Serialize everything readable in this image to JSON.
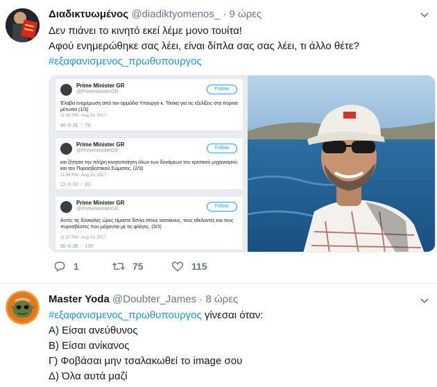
{
  "tweet1": {
    "name": "Διαδικτυωμένος",
    "handle": "@diadiktyomenos_",
    "separator": "·",
    "time": "9 ώρες",
    "line1": "Δεν πιάνει το κινητό εκεί λέμε μονο τουίτα!",
    "line2": "Αφού ενημερώθηκε σας λέει, είναι δίπλα σας σας λέει, τι άλλο θέτε?",
    "hashtag": "#εξαφανισμενος_πρωθυπουργος",
    "embedded": [
      {
        "name": "Prime Minister GR",
        "handle": "@PrimeministerGR",
        "follow": "Follow",
        "text": "Έλαβα ενημέρωση από τον αρμόδιο Υπουργό κ. Τόσκα για τις εξελίξεις στα πύρινα μέτωπα (1/3)",
        "time": "11:36 PM - Aug 13, 2017",
        "stats": "46   ⟲ 36   ♡ 79"
      },
      {
        "name": "Prime Minister GR",
        "handle": "@PrimeministerGR",
        "follow": "Follow",
        "text": "και ζήτησα την πλήρη κινητοποίηση όλων των δυνάμεων του κρατικού μηχανισμού και του Πυροσβεστικού Σώματος. (2/3)",
        "time": "11:36 PM - Aug 13, 2017",
        "stats": "22   ⟲ 33   ♡ 83"
      },
      {
        "name": "Prime Minister GR",
        "handle": "@PrimeministerGR",
        "follow": "Follow",
        "text": "Αυτές τις δύσκολες ώρες είμαστε δίπλα στους κατοίκους, τους εθελοντές και τους πυροσβέστες που μάχονται με τις φλόγες. (3/3)",
        "time": "11:37 PM - Aug 13, 2017",
        "stats": "90   ⟲ 38   ♡ 135"
      }
    ],
    "actions": {
      "replies": "1",
      "retweets": "75",
      "likes": "115"
    }
  },
  "tweet2": {
    "name": "Master Yoda",
    "handle": "@Doubter_James",
    "separator": "·",
    "time": "8 ώρες",
    "hashtag": "#εξαφανισμενος_πρωθυπουργος",
    "line1_rest": " γίνεσαι όταν:",
    "line2": "Α) Είσαι ανεύθυνος",
    "line3": "Β) Είσαι ανίκανος",
    "line4": "Γ) Φοβάσαι μην τσαλακωθεί το image σου",
    "line5": "Δ) Όλα αυτά μαζί"
  },
  "colors": {
    "link": "#1b95e0",
    "muted": "#657786",
    "text": "#14171a"
  },
  "icons": [
    "reply-icon",
    "retweet-icon",
    "like-icon",
    "chevron-down-icon"
  ]
}
